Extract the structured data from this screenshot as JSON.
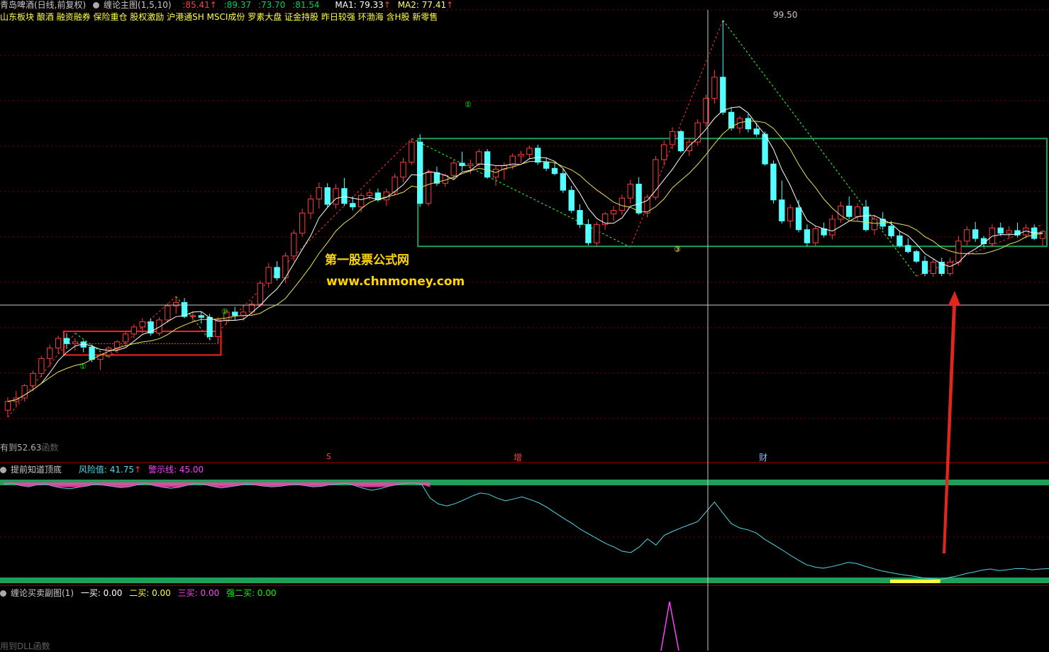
{
  "main_header": {
    "stock": "青岛啤酒(日线,前复权)",
    "indicator": "缠论主图(1,5,10)",
    "v1": ":85.41",
    "v2": ":89.37",
    "v3": ":73.70",
    "v4": ":81.54",
    "ma1": "MA1: 79.33",
    "ma2": "MA2: 77.41",
    "concepts": "山东板块 酿酒 融资融券 保险重仓 股权激励 沪港通SH MSCI成份 罗素大盘 证金持股 昨日较强  环渤海 含H股 新零售"
  },
  "annotations": {
    "peak": "99.50",
    "low": "52.63",
    "low_prefix": "有到",
    "dll1": "函数",
    "marker_s": "S",
    "marker_zeng": "增",
    "marker_cai": "财",
    "circle1": "①",
    "circle3": "③",
    "circle1b": "①",
    "circle1c": "①"
  },
  "panel2": {
    "title": "提前知道顶底",
    "risk": "风险值: 41.75",
    "warn": "警示线: 45.00"
  },
  "panel3": {
    "title": "缠论买卖副图(1)",
    "b1": "一买: 0.00",
    "b2": "二买: 0.00",
    "b3": "三买: 0.00",
    "b4": "强二买: 0.00",
    "dll": "用到DLL函数"
  },
  "watermark": {
    "line1": "第一股票公式网",
    "line2": "www.chnmoney.com"
  },
  "colors": {
    "up": "#ff3b3b",
    "down": "#54ffff",
    "ma1": "#ffffff",
    "ma2": "#e8e05a",
    "green_line": "#1ea05a",
    "risk_line": "#4fd8e8",
    "warn": "#ff40ff"
  },
  "chart_data": {
    "type": "candlestick",
    "ylim": [
      50,
      101
    ],
    "candles": [
      [
        55.0,
        56.5,
        54.2,
        56.0
      ],
      [
        56.0,
        57.2,
        55.5,
        56.4
      ],
      [
        56.4,
        58.0,
        56.0,
        57.8
      ],
      [
        57.8,
        59.5,
        57.2,
        59.2
      ],
      [
        59.2,
        61.2,
        58.8,
        60.9
      ],
      [
        60.9,
        62.5,
        60.0,
        62.1
      ],
      [
        62.1,
        63.5,
        61.4,
        63.2
      ],
      [
        63.2,
        63.8,
        62.0,
        62.6
      ],
      [
        62.6,
        63.2,
        61.8,
        62.8
      ],
      [
        62.8,
        63.0,
        61.6,
        62.2
      ],
      [
        62.2,
        62.5,
        60.5,
        60.8
      ],
      [
        60.8,
        61.5,
        59.6,
        61.3
      ],
      [
        61.3,
        62.3,
        61.0,
        62.1
      ],
      [
        62.1,
        63.0,
        61.5,
        62.8
      ],
      [
        62.8,
        64.0,
        62.3,
        63.7
      ],
      [
        63.7,
        64.8,
        63.2,
        64.5
      ],
      [
        64.5,
        65.5,
        63.8,
        65.1
      ],
      [
        65.1,
        65.5,
        63.5,
        63.8
      ],
      [
        63.8,
        65.6,
        63.5,
        65.3
      ],
      [
        65.3,
        67.2,
        65.0,
        66.9
      ],
      [
        66.9,
        68.0,
        66.0,
        67.3
      ],
      [
        67.3,
        67.8,
        65.5,
        65.7
      ],
      [
        65.7,
        66.3,
        65.0,
        65.8
      ],
      [
        65.8,
        66.2,
        64.9,
        65.6
      ],
      [
        65.6,
        66.0,
        63.0,
        63.4
      ],
      [
        63.4,
        65.6,
        62.6,
        65.3
      ],
      [
        65.3,
        66.5,
        64.8,
        66.2
      ],
      [
        66.2,
        66.8,
        65.3,
        65.8
      ],
      [
        65.8,
        67.0,
        65.2,
        66.2
      ],
      [
        66.2,
        67.5,
        65.8,
        67.1
      ],
      [
        67.1,
        69.8,
        66.8,
        69.5
      ],
      [
        69.5,
        71.8,
        69.0,
        71.3
      ],
      [
        71.3,
        72.0,
        69.8,
        70.1
      ],
      [
        70.1,
        73.0,
        69.5,
        72.6
      ],
      [
        72.6,
        75.6,
        72.0,
        75.2
      ],
      [
        75.2,
        78.0,
        74.8,
        77.5
      ],
      [
        77.5,
        79.6,
        76.8,
        79.1
      ],
      [
        79.1,
        81.0,
        78.0,
        80.4
      ],
      [
        80.4,
        80.9,
        78.2,
        78.5
      ],
      [
        78.5,
        80.8,
        78.0,
        80.3
      ],
      [
        80.3,
        81.5,
        78.3,
        78.6
      ],
      [
        78.6,
        79.4,
        77.8,
        78.2
      ],
      [
        78.2,
        79.8,
        77.6,
        79.5
      ],
      [
        79.5,
        80.3,
        79.0,
        79.8
      ],
      [
        79.8,
        80.3,
        78.8,
        79.0
      ],
      [
        79.0,
        80.3,
        78.3,
        79.9
      ],
      [
        79.9,
        82.0,
        79.5,
        81.6
      ],
      [
        81.6,
        83.8,
        81.0,
        83.3
      ],
      [
        83.3,
        86.0,
        83.0,
        85.6
      ],
      [
        85.6,
        86.5,
        78.2,
        78.6
      ],
      [
        78.6,
        82.5,
        78.3,
        82.1
      ],
      [
        82.1,
        82.8,
        80.6,
        80.9
      ],
      [
        80.9,
        82.0,
        80.5,
        81.8
      ],
      [
        81.8,
        83.5,
        81.4,
        83.2
      ],
      [
        83.2,
        84.5,
        82.3,
        82.9
      ],
      [
        82.9,
        83.6,
        82.0,
        83.1
      ],
      [
        83.1,
        84.8,
        82.8,
        84.5
      ],
      [
        84.5,
        84.8,
        81.4,
        81.6
      ],
      [
        81.6,
        82.9,
        80.6,
        82.5
      ],
      [
        82.5,
        83.3,
        81.3,
        82.9
      ],
      [
        82.9,
        84.3,
        82.5,
        84.0
      ],
      [
        84.0,
        84.6,
        83.2,
        84.2
      ],
      [
        84.2,
        85.2,
        83.7,
        84.9
      ],
      [
        84.9,
        85.3,
        83.0,
        83.3
      ],
      [
        83.3,
        83.8,
        82.3,
        82.6
      ],
      [
        82.6,
        83.3,
        81.8,
        82.0
      ],
      [
        82.0,
        82.5,
        79.8,
        80.1
      ],
      [
        80.1,
        80.6,
        77.5,
        77.8
      ],
      [
        77.8,
        78.5,
        75.8,
        76.2
      ],
      [
        76.2,
        76.8,
        73.8,
        74.1
      ],
      [
        74.1,
        76.5,
        73.6,
        76.2
      ],
      [
        76.2,
        77.6,
        75.6,
        77.4
      ],
      [
        77.4,
        78.3,
        76.6,
        77.8
      ],
      [
        77.8,
        79.6,
        77.3,
        79.2
      ],
      [
        79.2,
        81.3,
        78.6,
        80.8
      ],
      [
        80.8,
        81.6,
        77.3,
        77.5
      ],
      [
        77.5,
        79.6,
        77.0,
        79.3
      ],
      [
        79.3,
        84.0,
        79.0,
        83.6
      ],
      [
        83.6,
        85.8,
        82.9,
        85.3
      ],
      [
        85.3,
        87.3,
        84.8,
        86.8
      ],
      [
        86.8,
        87.0,
        84.4,
        84.6
      ],
      [
        84.6,
        86.0,
        84.0,
        85.6
      ],
      [
        85.6,
        88.2,
        85.2,
        87.8
      ],
      [
        87.8,
        91.0,
        87.3,
        90.6
      ],
      [
        90.6,
        93.8,
        90.0,
        93.0
      ],
      [
        93.0,
        99.5,
        88.7,
        89.0
      ],
      [
        89.0,
        89.6,
        86.9,
        87.2
      ],
      [
        87.2,
        88.6,
        86.6,
        88.3
      ],
      [
        88.3,
        88.8,
        86.7,
        87.1
      ],
      [
        87.1,
        87.8,
        86.2,
        86.5
      ],
      [
        86.5,
        86.8,
        82.9,
        83.1
      ],
      [
        83.1,
        83.5,
        78.6,
        79.0
      ],
      [
        79.0,
        81.2,
        76.3,
        76.6
      ],
      [
        76.6,
        78.5,
        75.8,
        78.1
      ],
      [
        78.1,
        79.0,
        75.3,
        75.6
      ],
      [
        75.6,
        76.2,
        73.7,
        74.1
      ],
      [
        74.1,
        76.0,
        73.7,
        75.7
      ],
      [
        75.7,
        76.4,
        74.7,
        75.0
      ],
      [
        75.0,
        77.3,
        74.5,
        76.8
      ],
      [
        76.8,
        78.8,
        76.4,
        78.3
      ],
      [
        78.3,
        79.4,
        76.8,
        77.1
      ],
      [
        77.1,
        78.6,
        76.6,
        78.2
      ],
      [
        78.2,
        79.0,
        75.4,
        75.6
      ],
      [
        75.6,
        77.3,
        75.0,
        76.8
      ],
      [
        76.8,
        77.6,
        75.6,
        76.0
      ],
      [
        76.0,
        76.6,
        74.6,
        74.9
      ],
      [
        74.9,
        75.4,
        73.6,
        73.8
      ],
      [
        73.8,
        74.6,
        72.9,
        73.1
      ],
      [
        73.1,
        73.3,
        71.8,
        72.0
      ],
      [
        72.0,
        72.6,
        70.3,
        70.6
      ],
      [
        70.6,
        72.3,
        70.2,
        71.9
      ],
      [
        71.9,
        72.4,
        70.3,
        70.6
      ],
      [
        70.6,
        72.4,
        70.3,
        71.9
      ],
      [
        71.9,
        74.9,
        71.5,
        74.3
      ],
      [
        74.3,
        76.0,
        73.8,
        75.6
      ],
      [
        75.6,
        76.5,
        74.2,
        74.6
      ],
      [
        74.6,
        74.9,
        73.6,
        74.0
      ],
      [
        74.0,
        76.2,
        73.6,
        75.8
      ],
      [
        75.8,
        76.4,
        74.9,
        75.2
      ],
      [
        75.2,
        76.0,
        74.6,
        75.5
      ],
      [
        75.5,
        76.4,
        74.7,
        75.0
      ],
      [
        75.0,
        76.2,
        74.6,
        75.8
      ],
      [
        75.8,
        76.2,
        74.4,
        74.6
      ],
      [
        74.6,
        75.6,
        73.8,
        75.4
      ]
    ],
    "risk": [
      44.5,
      44.8,
      44.2,
      43.9,
      44.4,
      44.6,
      44.0,
      43.6,
      43.4,
      43.8,
      44.1,
      44.6,
      44.3,
      44.0,
      43.7,
      43.9,
      44.4,
      44.8,
      44.2,
      43.8,
      43.5,
      43.8,
      44.3,
      44.7,
      44.5,
      44.0,
      43.6,
      43.9,
      44.2,
      44.6,
      44.4,
      44.1,
      43.9,
      44.0,
      44.3,
      44.5,
      44.2,
      43.9,
      44.0,
      44.4,
      44.6,
      44.8,
      44.2,
      43.5,
      43.0,
      43.4,
      44.0,
      44.4,
      44.8,
      44.9,
      44.5,
      41.0,
      39.5,
      39.0,
      39.6,
      40.5,
      41.5,
      42.3,
      42.0,
      41.0,
      40.3,
      40.8,
      41.3,
      40.6,
      39.8,
      38.6,
      37.2,
      35.8,
      34.5,
      33.0,
      31.8,
      30.6,
      29.4,
      28.5,
      27.4,
      27.1,
      28.5,
      30.6,
      29.0,
      31.5,
      32.5,
      33.4,
      34.2,
      35.0,
      37.5,
      40.0,
      37.2,
      34.5,
      33.4,
      32.9,
      32.1,
      30.5,
      29.2,
      27.9,
      26.5,
      25.2,
      24.0,
      23.4,
      23.1,
      23.5,
      24.0,
      24.6,
      24.3,
      23.6,
      23.0,
      22.4,
      22.0,
      21.6,
      21.3,
      21.0,
      20.6,
      20.4,
      20.2,
      20.7,
      21.1,
      21.7,
      22.1,
      22.6,
      22.9,
      22.5,
      22.7,
      23.0,
      23.0,
      22.7,
      22.9,
      23.0
    ],
    "risk_ylim": [
      20,
      45
    ],
    "warn_line": 45.0,
    "buy_signal_peak": 1.0
  }
}
